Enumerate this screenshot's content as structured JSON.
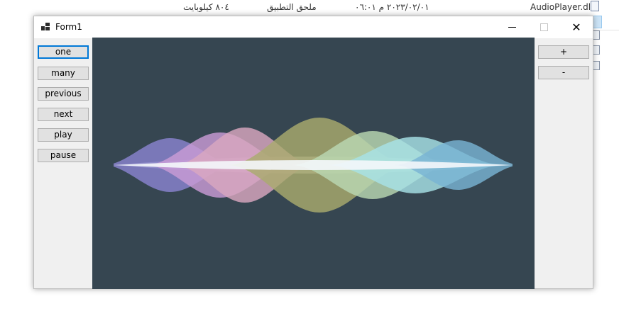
{
  "background": {
    "file_size": "٨٠٤ كيلوبايت",
    "file_type": "ملحق التطبيق",
    "file_date": "٢٠٢٣/٠٢/٠١ م ٠٦:٠١",
    "file_name": "AudioPlayer.dll"
  },
  "window": {
    "title": "Form1",
    "minimize_glyph": "–",
    "close_glyph": "✕"
  },
  "left_buttons": [
    "one",
    "many",
    "previous",
    "next",
    "play",
    "pause"
  ],
  "right_buttons": [
    "+",
    "-"
  ],
  "visualizer": {
    "background_color": "#364651",
    "wave_colors": [
      "#8a84cf",
      "#c99bd6",
      "#d9a7c0",
      "#a9ab6e",
      "#b9d8b2",
      "#a7e2e6",
      "#79b3d3"
    ]
  }
}
